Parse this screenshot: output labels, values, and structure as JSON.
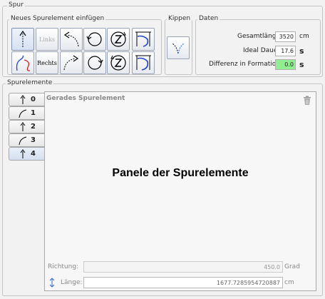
{
  "spur": {
    "title": "Spur",
    "neues": {
      "title": "Neues Spurelement einfügen",
      "links_label": "Links",
      "rechts_label": "Rechts"
    },
    "kippen": {
      "title": "Kippen"
    },
    "daten": {
      "title": "Daten",
      "rows": [
        {
          "label": "Gesamtlänge:",
          "value": "3520",
          "unit": "cm"
        },
        {
          "label": "Ideal Dauer:",
          "value": "17.6",
          "unit": "s"
        },
        {
          "label": "Differenz in Formation:",
          "value": "0.0",
          "unit": "s"
        }
      ],
      "highlight_color": "#90ee90"
    }
  },
  "spurelemente": {
    "title": "Spurelemente",
    "tabs": [
      {
        "num": "0",
        "icon": "straight-arrow-icon"
      },
      {
        "num": "1",
        "icon": "curve-arrow-icon"
      },
      {
        "num": "2",
        "icon": "straight-arrow-icon"
      },
      {
        "num": "3",
        "icon": "curve-arrow-icon"
      },
      {
        "num": "4",
        "icon": "straight-arrow-icon",
        "selected": true
      }
    ],
    "panel": {
      "title": "Gerades Spurelement",
      "center_text": "Panele der Spurelemente",
      "richtung_label": "Richtung:",
      "richtung_value": "450.0",
      "richtung_unit": "Grad",
      "laenge_label": "Länge:",
      "laenge_value": "1677.7285954720887",
      "laenge_unit": "cm"
    }
  }
}
